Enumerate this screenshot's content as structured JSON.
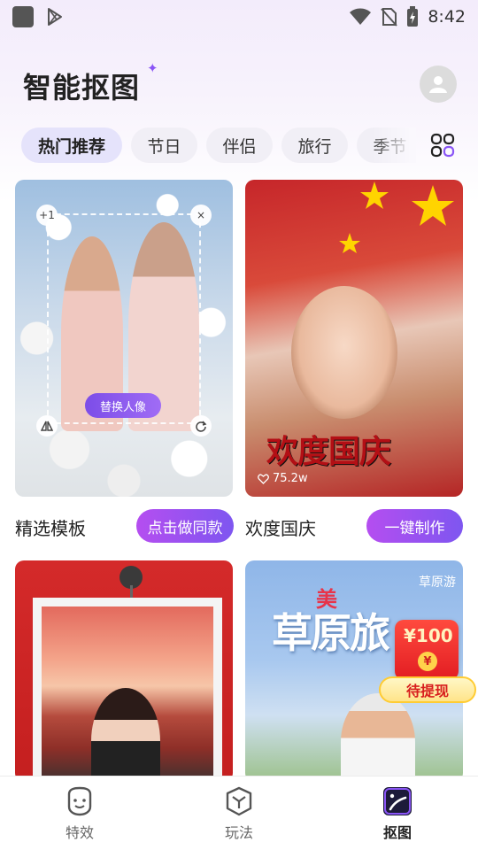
{
  "status_bar": {
    "time": "8:42",
    "icons": [
      "app-square-icon",
      "play-store-icon",
      "wifi-icon",
      "no-sim-icon",
      "battery-charging-icon"
    ]
  },
  "header": {
    "title": "智能抠图",
    "sparkle": "✦",
    "avatar_icon": "user-icon"
  },
  "tabs": [
    {
      "label": "热门推荐",
      "active": true
    },
    {
      "label": "节日",
      "active": false
    },
    {
      "label": "伴侣",
      "active": false
    },
    {
      "label": "旅行",
      "active": false
    },
    {
      "label": "季节",
      "active": false
    }
  ],
  "tabs_more_icon": "grid-icon",
  "cards": [
    {
      "caption": "精选模板",
      "action": "点击做同款",
      "overlay": {
        "replace_label": "替换人像",
        "top_left_badge": "+1",
        "top_right_badge": "×",
        "bottom_left_icon": "flip-icon",
        "bottom_right_icon": "rotate-icon"
      }
    },
    {
      "caption": "欢度国庆",
      "action": "一键制作",
      "calligraphy": "欢度国庆",
      "likes": "75.2w"
    },
    {
      "caption": ""
    },
    {
      "caption": "",
      "poster_title": "草原旅",
      "poster_accent": "美",
      "poster_corner": "草原游"
    }
  ],
  "promo": {
    "amount": "¥100",
    "coin": "¥",
    "label": "待提现"
  },
  "bottom_nav": [
    {
      "label": "特效",
      "icon": "face-icon",
      "active": false
    },
    {
      "label": "玩法",
      "icon": "cube-icon",
      "active": false
    },
    {
      "label": "抠图",
      "icon": "cutout-icon",
      "active": true
    }
  ],
  "colors": {
    "accent": "#7e56f0",
    "accent_pink": "#b54ef0",
    "tab_active_bg": "#e5e3fb",
    "promo_red": "#e21d22"
  }
}
